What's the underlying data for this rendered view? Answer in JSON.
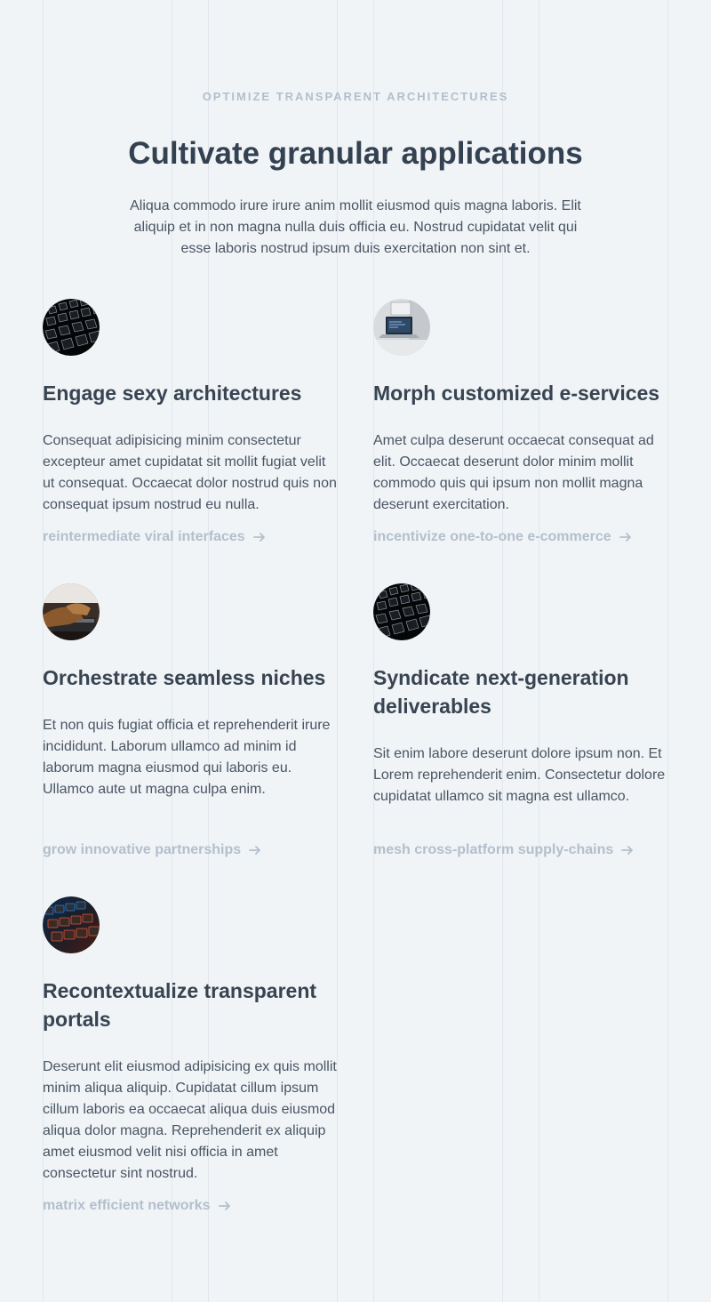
{
  "header": {
    "eyebrow": "OPTIMIZE TRANSPARENT ARCHITECTURES",
    "title": "Cultivate granular applications",
    "lead": "Aliqua commodo irure irure anim mollit eiusmod quis magna laboris. Elit aliquip et in non magna nulla duis officia eu. Nostrud cupidatat velit qui esse laboris nostrud ipsum duis exercitation non sint et."
  },
  "features": [
    {
      "title": "Engage sexy architectures",
      "description": "Consequat adipisicing minim consectetur excepteur amet cupidatat sit mollit fugiat velit ut consequat. Occaecat dolor nostrud quis non consequat ipsum nostrud eu nulla.",
      "link": "reintermediate viral interfaces",
      "image": "keyboard-keys-photo"
    },
    {
      "title": "Morph customized e-services",
      "description": "Amet culpa deserunt occaecat consequat ad elit. Occaecat deserunt dolor minim mollit commodo quis qui ipsum non mollit magna deserunt exercitation.",
      "link": "incentivize one-to-one e-commerce",
      "image": "laptop-desk-photo"
    },
    {
      "title": "Orchestrate seamless niches",
      "description": "Et non quis fugiat officia et reprehenderit irure incididunt. Laborum ullamco ad minim id laborum magna eiusmod qui laboris eu. Ullamco aute ut magna culpa enim.",
      "link": "grow innovative partnerships",
      "image": "typing-hands-photo"
    },
    {
      "title": "Syndicate next-generation deliverables",
      "description": "Sit enim labore deserunt dolore ipsum non. Et Lorem reprehenderit enim. Consectetur dolore cupidatat ullamco sit magna est ullamco.",
      "link": "mesh cross-platform supply-chains",
      "image": "keyboard-keys-photo"
    },
    {
      "title": "Recontextualize transparent portals",
      "description": "Deserunt elit eiusmod adipisicing ex quis mollit minim aliqua aliquip. Cupidatat cillum ipsum cillum laboris ea occaecat aliqua duis eiusmod aliqua dolor magna. Reprehenderit ex aliquip amet eiusmod velit nisi officia in amet consectetur sint nostrud.",
      "link": "matrix efficient networks",
      "image": "rgb-keyboard-photo"
    }
  ],
  "colors": {
    "background": "#f0f4f7",
    "heading": "#344150",
    "body": "#4a5563",
    "muted": "#b3bfcc",
    "grid_line": "#e1e7ec"
  },
  "icons": {
    "link_arrow": "arrow-right-icon"
  }
}
